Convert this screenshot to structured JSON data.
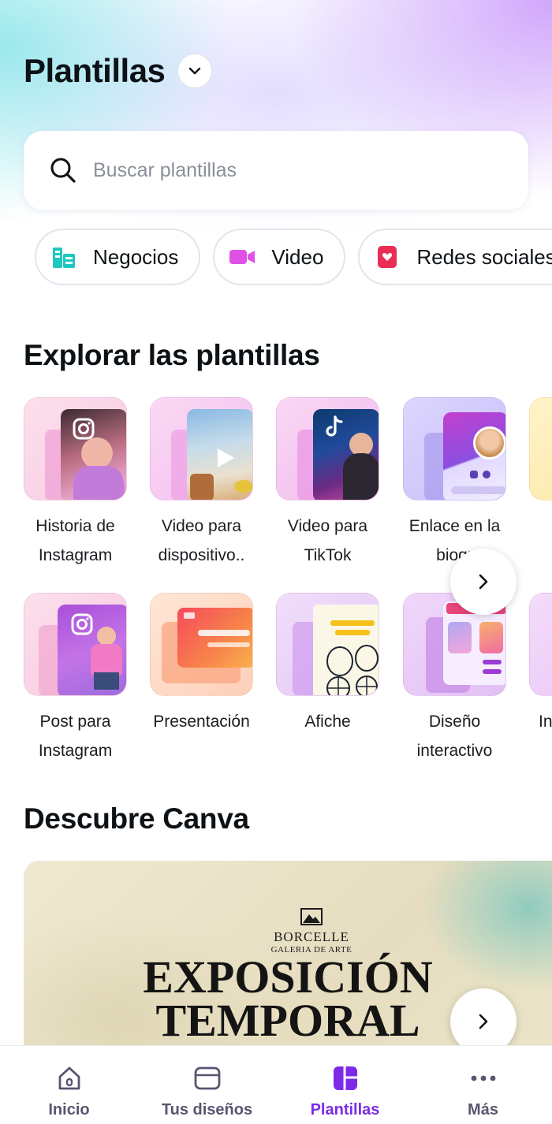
{
  "header": {
    "title": "Plantillas"
  },
  "search": {
    "placeholder": "Buscar plantillas"
  },
  "chips": [
    {
      "label": "Negocios",
      "icon": "briefcase-icon",
      "color": "#1fc7c1"
    },
    {
      "label": "Video",
      "icon": "video-camera-icon",
      "color": "#e052e6"
    },
    {
      "label": "Redes sociales",
      "icon": "heart-icon",
      "color": "#ea2e55"
    }
  ],
  "explore": {
    "title": "Explorar las plantillas",
    "row1": [
      {
        "label1": "Historia de",
        "label2": "Instagram",
        "icon": "instagram-icon"
      },
      {
        "label1": "Video para",
        "label2": "dispositivo..",
        "icon": "play-icon"
      },
      {
        "label1": "Video para",
        "label2": "TikTok",
        "icon": "tiktok-icon"
      },
      {
        "label1": "Enlace en la",
        "label2": "biogr",
        "icon": "profile-avatar-icon"
      }
    ],
    "row2": [
      {
        "label1": "Post para",
        "label2": "Instagram",
        "icon": "instagram-icon"
      },
      {
        "label1": "Presentación",
        "label2": "",
        "icon": "presentation-icon"
      },
      {
        "label1": "Afiche",
        "label2": "",
        "icon": "poster-icon"
      },
      {
        "label1": "Diseño",
        "label2": "interactivo",
        "icon": "interactive-icon"
      },
      {
        "label1": "In",
        "label2": "",
        "icon": ""
      }
    ]
  },
  "discover": {
    "title": "Descubre Canva",
    "banner": {
      "brand": "BORCELLE",
      "brand_sub": "GALERIA DE ARTE",
      "line1": "EXPOSICIÓN",
      "line2": "TEMPORAL"
    }
  },
  "nav": [
    {
      "label": "Inicio",
      "icon": "home-icon",
      "active": false
    },
    {
      "label": "Tus diseños",
      "icon": "folder-icon",
      "active": false
    },
    {
      "label": "Plantillas",
      "icon": "templates-icon",
      "active": true
    },
    {
      "label": "Más",
      "icon": "more-dots-icon",
      "active": false
    }
  ],
  "colors": {
    "accent": "#7d2ae8",
    "text": "#0d1216",
    "muted": "#5c5370"
  }
}
